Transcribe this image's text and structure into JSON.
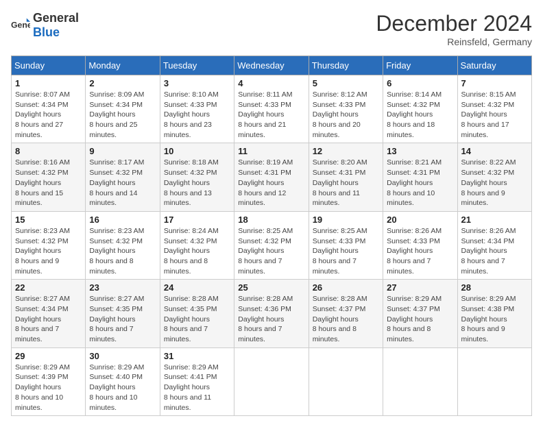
{
  "header": {
    "logo_general": "General",
    "logo_blue": "Blue",
    "month_title": "December 2024",
    "subtitle": "Reinsfeld, Germany"
  },
  "weekdays": [
    "Sunday",
    "Monday",
    "Tuesday",
    "Wednesday",
    "Thursday",
    "Friday",
    "Saturday"
  ],
  "weeks": [
    [
      {
        "day": "1",
        "sunrise": "8:07 AM",
        "sunset": "4:34 PM",
        "daylight": "8 hours and 27 minutes."
      },
      {
        "day": "2",
        "sunrise": "8:09 AM",
        "sunset": "4:34 PM",
        "daylight": "8 hours and 25 minutes."
      },
      {
        "day": "3",
        "sunrise": "8:10 AM",
        "sunset": "4:33 PM",
        "daylight": "8 hours and 23 minutes."
      },
      {
        "day": "4",
        "sunrise": "8:11 AM",
        "sunset": "4:33 PM",
        "daylight": "8 hours and 21 minutes."
      },
      {
        "day": "5",
        "sunrise": "8:12 AM",
        "sunset": "4:33 PM",
        "daylight": "8 hours and 20 minutes."
      },
      {
        "day": "6",
        "sunrise": "8:14 AM",
        "sunset": "4:32 PM",
        "daylight": "8 hours and 18 minutes."
      },
      {
        "day": "7",
        "sunrise": "8:15 AM",
        "sunset": "4:32 PM",
        "daylight": "8 hours and 17 minutes."
      }
    ],
    [
      {
        "day": "8",
        "sunrise": "8:16 AM",
        "sunset": "4:32 PM",
        "daylight": "8 hours and 15 minutes."
      },
      {
        "day": "9",
        "sunrise": "8:17 AM",
        "sunset": "4:32 PM",
        "daylight": "8 hours and 14 minutes."
      },
      {
        "day": "10",
        "sunrise": "8:18 AM",
        "sunset": "4:32 PM",
        "daylight": "8 hours and 13 minutes."
      },
      {
        "day": "11",
        "sunrise": "8:19 AM",
        "sunset": "4:31 PM",
        "daylight": "8 hours and 12 minutes."
      },
      {
        "day": "12",
        "sunrise": "8:20 AM",
        "sunset": "4:31 PM",
        "daylight": "8 hours and 11 minutes."
      },
      {
        "day": "13",
        "sunrise": "8:21 AM",
        "sunset": "4:31 PM",
        "daylight": "8 hours and 10 minutes."
      },
      {
        "day": "14",
        "sunrise": "8:22 AM",
        "sunset": "4:32 PM",
        "daylight": "8 hours and 9 minutes."
      }
    ],
    [
      {
        "day": "15",
        "sunrise": "8:23 AM",
        "sunset": "4:32 PM",
        "daylight": "8 hours and 9 minutes."
      },
      {
        "day": "16",
        "sunrise": "8:23 AM",
        "sunset": "4:32 PM",
        "daylight": "8 hours and 8 minutes."
      },
      {
        "day": "17",
        "sunrise": "8:24 AM",
        "sunset": "4:32 PM",
        "daylight": "8 hours and 8 minutes."
      },
      {
        "day": "18",
        "sunrise": "8:25 AM",
        "sunset": "4:32 PM",
        "daylight": "8 hours and 7 minutes."
      },
      {
        "day": "19",
        "sunrise": "8:25 AM",
        "sunset": "4:33 PM",
        "daylight": "8 hours and 7 minutes."
      },
      {
        "day": "20",
        "sunrise": "8:26 AM",
        "sunset": "4:33 PM",
        "daylight": "8 hours and 7 minutes."
      },
      {
        "day": "21",
        "sunrise": "8:26 AM",
        "sunset": "4:34 PM",
        "daylight": "8 hours and 7 minutes."
      }
    ],
    [
      {
        "day": "22",
        "sunrise": "8:27 AM",
        "sunset": "4:34 PM",
        "daylight": "8 hours and 7 minutes."
      },
      {
        "day": "23",
        "sunrise": "8:27 AM",
        "sunset": "4:35 PM",
        "daylight": "8 hours and 7 minutes."
      },
      {
        "day": "24",
        "sunrise": "8:28 AM",
        "sunset": "4:35 PM",
        "daylight": "8 hours and 7 minutes."
      },
      {
        "day": "25",
        "sunrise": "8:28 AM",
        "sunset": "4:36 PM",
        "daylight": "8 hours and 7 minutes."
      },
      {
        "day": "26",
        "sunrise": "8:28 AM",
        "sunset": "4:37 PM",
        "daylight": "8 hours and 8 minutes."
      },
      {
        "day": "27",
        "sunrise": "8:29 AM",
        "sunset": "4:37 PM",
        "daylight": "8 hours and 8 minutes."
      },
      {
        "day": "28",
        "sunrise": "8:29 AM",
        "sunset": "4:38 PM",
        "daylight": "8 hours and 9 minutes."
      }
    ],
    [
      {
        "day": "29",
        "sunrise": "8:29 AM",
        "sunset": "4:39 PM",
        "daylight": "8 hours and 10 minutes."
      },
      {
        "day": "30",
        "sunrise": "8:29 AM",
        "sunset": "4:40 PM",
        "daylight": "8 hours and 10 minutes."
      },
      {
        "day": "31",
        "sunrise": "8:29 AM",
        "sunset": "4:41 PM",
        "daylight": "8 hours and 11 minutes."
      },
      null,
      null,
      null,
      null
    ]
  ],
  "labels": {
    "sunrise": "Sunrise:",
    "sunset": "Sunset:",
    "daylight": "Daylight hours"
  }
}
